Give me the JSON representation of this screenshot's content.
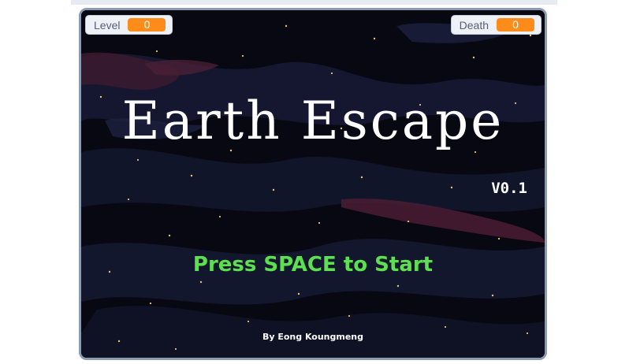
{
  "monitors": {
    "level": {
      "label": "Level",
      "value": "0"
    },
    "death": {
      "label": "Death",
      "value": "0"
    }
  },
  "title_screen": {
    "title": "Earth Escape",
    "version": "V0.1",
    "prompt": "Press SPACE to Start",
    "credit": "By Eong Koungmeng"
  },
  "colors": {
    "monitor_value": "#ff8c1a",
    "prompt_text": "#5de050",
    "stage_background": "#07070f",
    "stage_border": "#8d9bb0"
  }
}
